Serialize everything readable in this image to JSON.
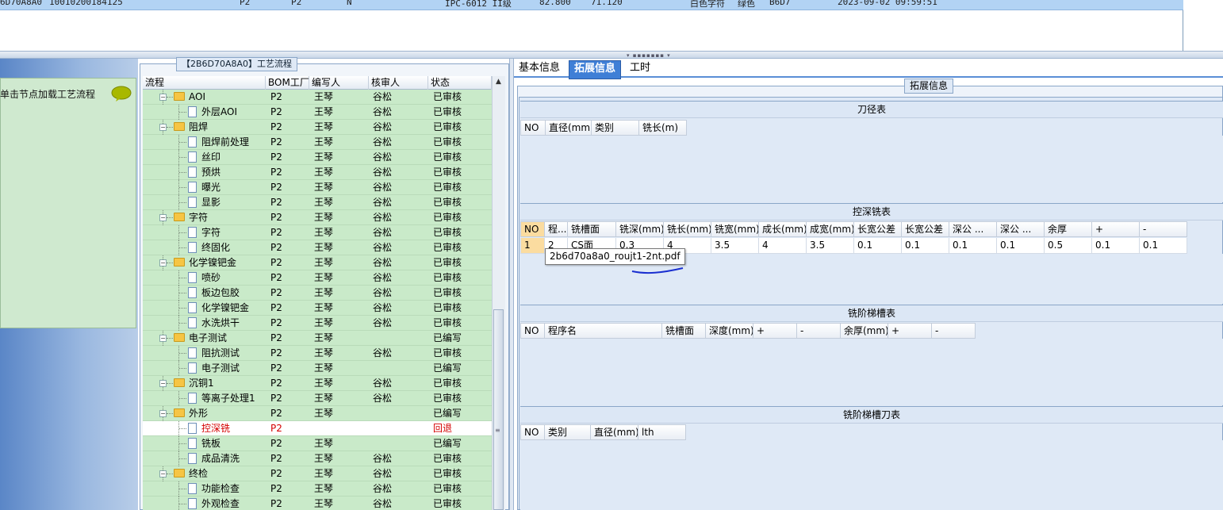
{
  "top_row": {
    "col1": "6D70A8A0",
    "col2": "10010200184125",
    "col3": "P2",
    "col4": "P2",
    "col5": "N",
    "col6": "IPC-6012 II级",
    "col7": "82.800",
    "col8": "71.120",
    "col9": "白色字符",
    "col10": "绿色",
    "col11": "B6D7",
    "col12": "2023-09-02 09:59:51"
  },
  "left": {
    "hint": "单击节点加载工艺流程",
    "hint_icon": "speech-bubble-icon"
  },
  "tree": {
    "caption": "【2B6D70A8A0】工艺流程",
    "headers": [
      "流程",
      "BOM工厂",
      "编写人",
      "核审人",
      "状态"
    ],
    "rows": [
      {
        "name": "AOI",
        "type": "folder",
        "factory": "P2",
        "writer": "王琴",
        "reviewer": "谷松",
        "status": "已审核"
      },
      {
        "name": "外层AOI",
        "type": "doc",
        "factory": "P2",
        "writer": "王琴",
        "reviewer": "谷松",
        "status": "已审核"
      },
      {
        "name": "阻焊",
        "type": "folder",
        "factory": "P2",
        "writer": "王琴",
        "reviewer": "谷松",
        "status": "已审核"
      },
      {
        "name": "阻焊前处理",
        "type": "doc",
        "factory": "P2",
        "writer": "王琴",
        "reviewer": "谷松",
        "status": "已审核"
      },
      {
        "name": "丝印",
        "type": "doc",
        "factory": "P2",
        "writer": "王琴",
        "reviewer": "谷松",
        "status": "已审核"
      },
      {
        "name": "预烘",
        "type": "doc",
        "factory": "P2",
        "writer": "王琴",
        "reviewer": "谷松",
        "status": "已审核"
      },
      {
        "name": "曝光",
        "type": "doc",
        "factory": "P2",
        "writer": "王琴",
        "reviewer": "谷松",
        "status": "已审核"
      },
      {
        "name": "显影",
        "type": "doc",
        "factory": "P2",
        "writer": "王琴",
        "reviewer": "谷松",
        "status": "已审核"
      },
      {
        "name": "字符",
        "type": "folder",
        "factory": "P2",
        "writer": "王琴",
        "reviewer": "谷松",
        "status": "已审核"
      },
      {
        "name": "字符",
        "type": "doc",
        "factory": "P2",
        "writer": "王琴",
        "reviewer": "谷松",
        "status": "已审核"
      },
      {
        "name": "终固化",
        "type": "doc",
        "factory": "P2",
        "writer": "王琴",
        "reviewer": "谷松",
        "status": "已审核"
      },
      {
        "name": "化学镍钯金",
        "type": "folder",
        "factory": "P2",
        "writer": "王琴",
        "reviewer": "谷松",
        "status": "已审核"
      },
      {
        "name": "喷砂",
        "type": "doc",
        "factory": "P2",
        "writer": "王琴",
        "reviewer": "谷松",
        "status": "已审核"
      },
      {
        "name": "板边包胶",
        "type": "doc",
        "factory": "P2",
        "writer": "王琴",
        "reviewer": "谷松",
        "status": "已审核"
      },
      {
        "name": "化学镍钯金",
        "type": "doc",
        "factory": "P2",
        "writer": "王琴",
        "reviewer": "谷松",
        "status": "已审核"
      },
      {
        "name": "水洗烘干",
        "type": "doc",
        "factory": "P2",
        "writer": "王琴",
        "reviewer": "谷松",
        "status": "已审核"
      },
      {
        "name": "电子测试",
        "type": "folder",
        "factory": "P2",
        "writer": "王琴",
        "reviewer": "",
        "status": "已编写"
      },
      {
        "name": "阻抗测试",
        "type": "doc",
        "factory": "P2",
        "writer": "王琴",
        "reviewer": "谷松",
        "status": "已审核"
      },
      {
        "name": "电子测试",
        "type": "doc",
        "factory": "P2",
        "writer": "王琴",
        "reviewer": "",
        "status": "已编写"
      },
      {
        "name": "沉铜1",
        "type": "folder",
        "factory": "P2",
        "writer": "王琴",
        "reviewer": "谷松",
        "status": "已审核"
      },
      {
        "name": "等离子处理1",
        "type": "doc",
        "factory": "P2",
        "writer": "王琴",
        "reviewer": "谷松",
        "status": "已审核"
      },
      {
        "name": "外形",
        "type": "folder",
        "factory": "P2",
        "writer": "王琴",
        "reviewer": "",
        "status": "已编写"
      },
      {
        "name": "控深铣",
        "type": "doc",
        "factory": "P2",
        "writer": "",
        "reviewer": "",
        "status": "回退",
        "selected": true
      },
      {
        "name": "铣板",
        "type": "doc",
        "factory": "P2",
        "writer": "王琴",
        "reviewer": "",
        "status": "已编写"
      },
      {
        "name": "成品清洗",
        "type": "doc",
        "factory": "P2",
        "writer": "王琴",
        "reviewer": "谷松",
        "status": "已审核"
      },
      {
        "name": "终检",
        "type": "folder",
        "factory": "P2",
        "writer": "王琴",
        "reviewer": "谷松",
        "status": "已审核"
      },
      {
        "name": "功能检查",
        "type": "doc",
        "factory": "P2",
        "writer": "王琴",
        "reviewer": "谷松",
        "status": "已审核"
      },
      {
        "name": "外观检查",
        "type": "doc",
        "factory": "P2",
        "writer": "王琴",
        "reviewer": "谷松",
        "status": "已审核"
      }
    ]
  },
  "tabs": [
    {
      "label": "基本信息",
      "active": false
    },
    {
      "label": "拓展信息",
      "active": true
    },
    {
      "label": "工时",
      "active": false
    }
  ],
  "ext": {
    "caption": "拓展信息",
    "tool_table": {
      "title": "刀径表",
      "headers": [
        "NO",
        "直径(mm)",
        "类别",
        "铣长(m)"
      ]
    },
    "depth_table": {
      "title": "控深铣表",
      "headers": [
        "NO",
        "程...",
        "铣槽面",
        "铣深(mm)",
        "铣长(mm)",
        "铣宽(mm)",
        "成长(mm)",
        "成宽(mm)",
        "长宽公差",
        "长宽公差",
        "深公 ...",
        "深公 ...",
        "余厚",
        "+",
        "-"
      ],
      "row": [
        "1",
        "2",
        "CS面",
        "0.3",
        "4",
        "3.5",
        "4",
        "3.5",
        "0.1",
        "0.1",
        "0.1",
        "0.1",
        "0.5",
        "0.1",
        "0.1"
      ]
    },
    "step_table": {
      "title": "铣阶梯槽表",
      "headers": [
        "NO",
        "程序名",
        "铣槽面",
        "深度(mm)",
        "+",
        "-",
        "余厚(mm)",
        "+",
        "-"
      ]
    },
    "step_tool_table": {
      "title": "铣阶梯槽刀表",
      "headers": [
        "NO",
        "类别",
        "直径(mm)",
        "lth"
      ]
    }
  },
  "tooltip": "2b6d70a8a0_roujt1-2nt.pdf"
}
